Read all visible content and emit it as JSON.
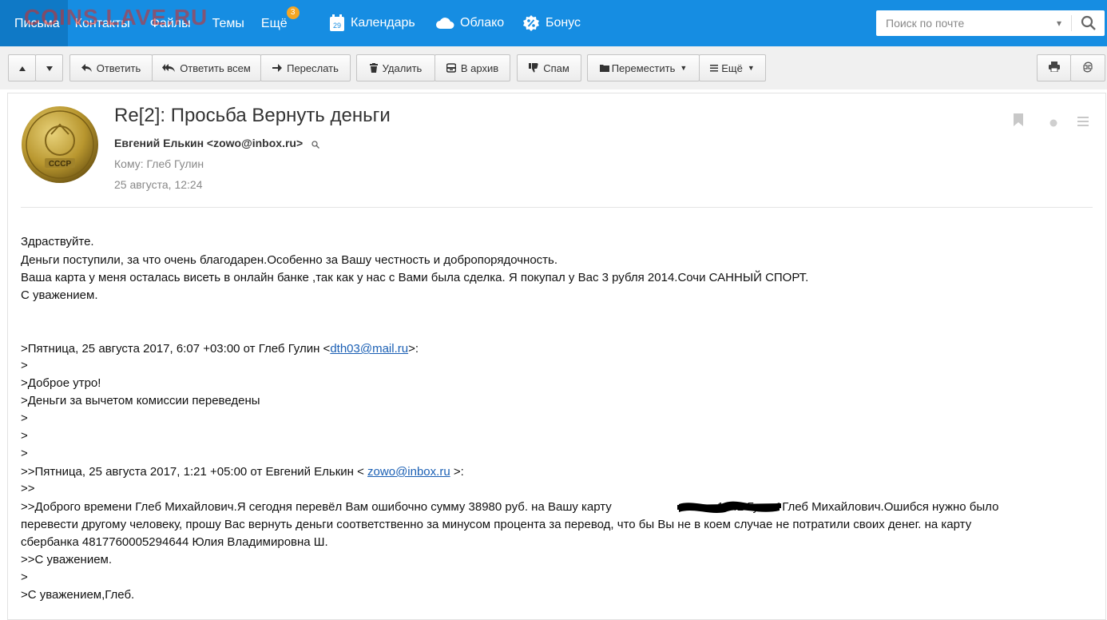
{
  "watermark": "COINS.LAVE.RU",
  "nav": {
    "items": [
      "Письма",
      "Контакты",
      "Файлы",
      "Темы",
      "Ещё"
    ],
    "badge": "3",
    "services": [
      {
        "label": "Календарь",
        "icon": "calendar-icon",
        "icon_text": "29"
      },
      {
        "label": "Облако",
        "icon": "cloud-icon"
      },
      {
        "label": "Бонус",
        "icon": "bonus-percent-icon"
      }
    ]
  },
  "search": {
    "placeholder": "Поиск по почте"
  },
  "toolbar": {
    "reply": "Ответить",
    "reply_all": "Ответить всем",
    "forward": "Переслать",
    "delete": "Удалить",
    "archive": "В архив",
    "spam": "Спам",
    "move": "Переместить",
    "more": "Ещё"
  },
  "message": {
    "subject": "Re[2]: Просьба Вернуть деньги",
    "from": "Евгений Елькин <zowo@inbox.ru>",
    "to": "Кому: Глеб Гулин",
    "date": "25 августа, 12:24",
    "avatar_text": "СССР",
    "body": [
      "Здраствуйте.",
      "Деньги поступили, за что очень благодарен.Особенно за Вашу честность и добропорядочность.",
      "Ваша карта у меня осталась висеть в онлайн банке ,так как у нас с Вами была сделка. Я покупал у Вас  3 рубля 2014.Сочи САННЫЙ СПОРТ.",
      "С уважением."
    ],
    "quote": {
      "header1_pre": ">Пятница, 25 августа 2017, 6:07 +03:00 от Глеб Гулин <",
      "header1_link": "dth03@mail.ru",
      "header1_post": ">:",
      "gt": ">",
      "line_morning": ">Доброе утро!",
      "line_money": ">Деньги за вычетом комиссии переведены",
      "header2_pre": ">>Пятница, 25 августа 2017, 1:21 +05:00 от Евгений Елькин < ",
      "header2_link": "zowo@inbox.ru",
      "header2_post": " >:",
      "gtgt": ">>",
      "para1_pre": ">>Доброго времени  Глеб Михайлович.Я сегодня перевёл Вам ошибочно сумму 38980 руб. на Вашу карту",
      "para1_post": "1242 Гулин Глеб Михайлович.Ошибся нужно было",
      "para2": "перевести другому человеку, прошу Вас вернуть деньги соответственно за минусом процента за перевод, что бы Вы не в коем случае не потратили своих денег. на карту",
      "para3": "сбербанка 4817760005294644 Юлия Владимировна Ш.",
      "regards2": ">>С уважением.",
      "regards1": ">С уважением,Глеб."
    }
  }
}
